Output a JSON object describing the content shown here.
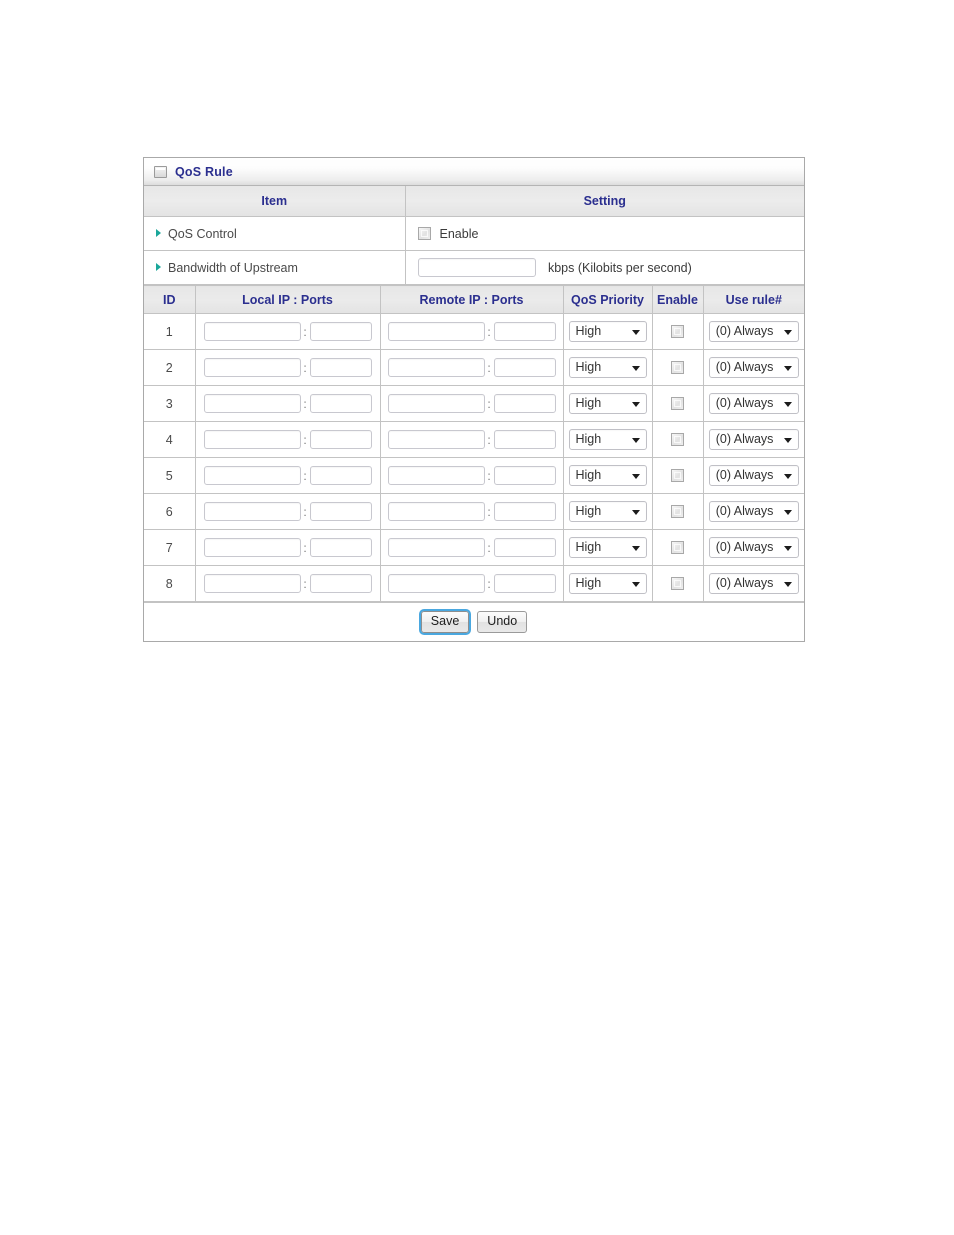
{
  "panel": {
    "title": "QoS Rule",
    "title_icon": "minimize-square-icon"
  },
  "settings_header": {
    "item": "Item",
    "setting": "Setting"
  },
  "settings_rows": [
    {
      "label": "QoS Control",
      "control": "checkbox",
      "checkbox_label": "Enable",
      "checked": false
    },
    {
      "label": "Bandwidth of Upstream",
      "control": "text",
      "value": "",
      "unit": "kbps (Kilobits per second)"
    }
  ],
  "rules_table": {
    "columns": [
      "ID",
      "Local IP : Ports",
      "Remote IP : Ports",
      "QoS Priority",
      "Enable",
      "Use rule#"
    ],
    "separator": ":",
    "rows": [
      {
        "id": "1",
        "local_ip": "",
        "local_port": "",
        "remote_ip": "",
        "remote_port": "",
        "priority": "High",
        "enable": false,
        "use_rule": "(0) Always"
      },
      {
        "id": "2",
        "local_ip": "",
        "local_port": "",
        "remote_ip": "",
        "remote_port": "",
        "priority": "High",
        "enable": false,
        "use_rule": "(0) Always"
      },
      {
        "id": "3",
        "local_ip": "",
        "local_port": "",
        "remote_ip": "",
        "remote_port": "",
        "priority": "High",
        "enable": false,
        "use_rule": "(0) Always"
      },
      {
        "id": "4",
        "local_ip": "",
        "local_port": "",
        "remote_ip": "",
        "remote_port": "",
        "priority": "High",
        "enable": false,
        "use_rule": "(0) Always"
      },
      {
        "id": "5",
        "local_ip": "",
        "local_port": "",
        "remote_ip": "",
        "remote_port": "",
        "priority": "High",
        "enable": false,
        "use_rule": "(0) Always"
      },
      {
        "id": "6",
        "local_ip": "",
        "local_port": "",
        "remote_ip": "",
        "remote_port": "",
        "priority": "High",
        "enable": false,
        "use_rule": "(0) Always"
      },
      {
        "id": "7",
        "local_ip": "",
        "local_port": "",
        "remote_ip": "",
        "remote_port": "",
        "priority": "High",
        "enable": false,
        "use_rule": "(0) Always"
      },
      {
        "id": "8",
        "local_ip": "",
        "local_port": "",
        "remote_ip": "",
        "remote_port": "",
        "priority": "High",
        "enable": false,
        "use_rule": "(0) Always"
      }
    ]
  },
  "footer": {
    "save_label": "Save",
    "undo_label": "Undo"
  },
  "colors": {
    "heading_blue": "#2b2f8f",
    "bullet_teal": "#1aa79a",
    "focus_ring": "#4aa8e0",
    "border_gray": "#c3c3c3"
  }
}
